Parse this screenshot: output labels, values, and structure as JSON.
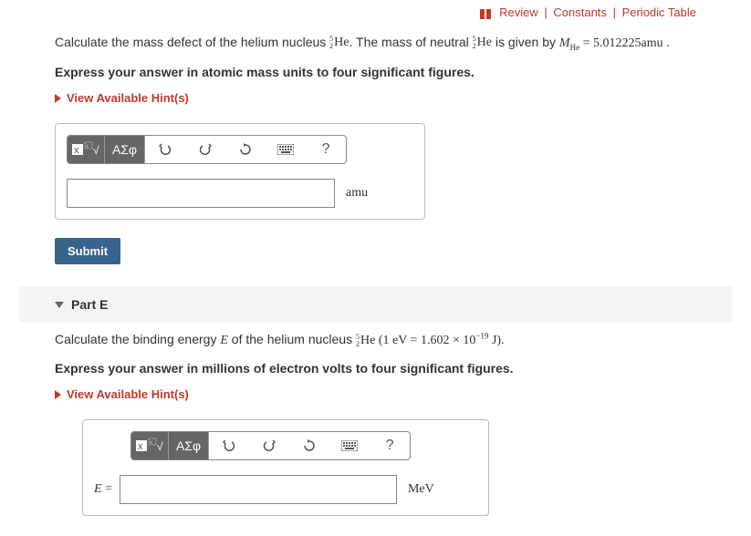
{
  "topLinks": {
    "review": "Review",
    "constants": "Constants",
    "periodic": "Periodic Table"
  },
  "partD": {
    "prompt_pre": "Calculate the mass defect of the helium nucleus ",
    "nuc_top": "5",
    "nuc_bot": "2",
    "nuc_sym": "He",
    "prompt_mid": ". The mass of neutral ",
    "prompt_post": " is given by ",
    "mass_label": "M",
    "mass_sub": "He",
    "mass_eq": " = 5.012225amu .",
    "instruction": "Express your answer in atomic mass units to four significant figures.",
    "hints": "View Available Hint(s)",
    "unit": "amu",
    "submit": "Submit",
    "toolbar": {
      "templates": "|x̄|√x̄",
      "greek": "ΑΣφ",
      "help": "?"
    }
  },
  "partE": {
    "header": "Part E",
    "prompt_pre": "Calculate the binding energy ",
    "E": "E",
    "prompt_mid": " of the helium nucleus ",
    "nuc_top": "5",
    "nuc_bot": "2",
    "nuc_sym": "He",
    "ev_expr": " (1 eV = 1.602 × 10",
    "ev_exp": "−19",
    "ev_end": " J).",
    "instruction": "Express your answer in millions of electron volts to four significant figures.",
    "hints": "View Available Hint(s)",
    "prefix_E": "E",
    "prefix_eq": " =",
    "unit": "MeV",
    "toolbar": {
      "templates": "|x̄|√x̄",
      "greek": "ΑΣφ",
      "help": "?"
    }
  }
}
